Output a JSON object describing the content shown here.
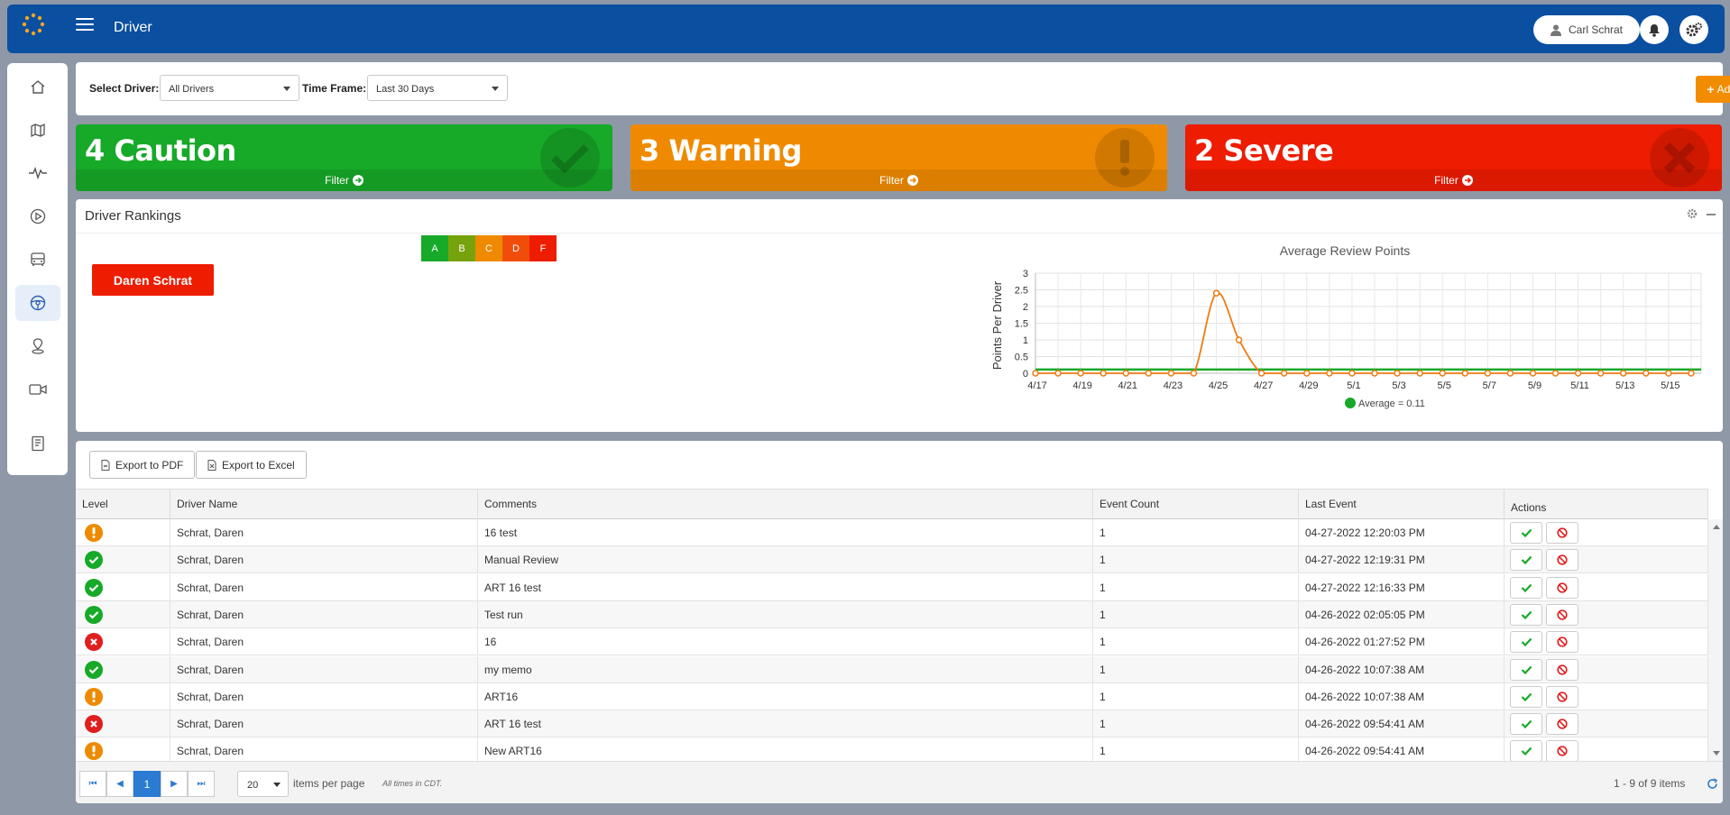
{
  "header": {
    "title": "Driver",
    "user_name": "Carl Schrat"
  },
  "filters": {
    "driver_label": "Select Driver:",
    "driver_value": "All Drivers",
    "timeframe_label": "Time Frame:",
    "timeframe_value": "Last 30 Days",
    "add_review_label": "Add Review"
  },
  "cards": [
    {
      "title": "4 Caution",
      "filter_label": "Filter",
      "color": "#17a928"
    },
    {
      "title": "3 Warning",
      "filter_label": "Filter",
      "color": "#ef8a00"
    },
    {
      "title": "2 Severe",
      "filter_label": "Filter",
      "color": "#ee1c00"
    }
  ],
  "rankings": {
    "title": "Driver Rankings",
    "grades": [
      {
        "label": "A",
        "color": "#17a928"
      },
      {
        "label": "B",
        "color": "#76a20c"
      },
      {
        "label": "C",
        "color": "#ef8a00"
      },
      {
        "label": "D",
        "color": "#f04d0b"
      },
      {
        "label": "F",
        "color": "#ee1c00"
      }
    ],
    "driver_button": "Daren Schrat"
  },
  "chart_data": {
    "type": "line",
    "title": "Average Review Points",
    "ylabel": "Points Per Driver",
    "xlabel": "",
    "ylim": [
      0,
      3
    ],
    "yticks": [
      "0",
      "0.5",
      "1",
      "1.5",
      "2",
      "2.5",
      "3"
    ],
    "x_tick_labels": [
      "4/17",
      "4/19",
      "4/21",
      "4/23",
      "4/25",
      "4/27",
      "4/29",
      "5/1",
      "5/3",
      "5/5",
      "5/7",
      "5/9",
      "5/11",
      "5/13",
      "5/15"
    ],
    "x": [
      "4/17",
      "4/18",
      "4/19",
      "4/20",
      "4/21",
      "4/22",
      "4/23",
      "4/24",
      "4/25",
      "4/26",
      "4/27",
      "4/28",
      "4/29",
      "4/30",
      "5/1",
      "5/2",
      "5/3",
      "5/4",
      "5/5",
      "5/6",
      "5/7",
      "5/8",
      "5/9",
      "5/10",
      "5/11",
      "5/12",
      "5/13",
      "5/14",
      "5/15",
      "5/16"
    ],
    "series": [
      {
        "values": [
          0,
          0,
          0,
          0,
          0,
          0,
          0,
          0,
          2.4,
          1.0,
          0,
          0,
          0,
          0,
          0,
          0,
          0,
          0,
          0,
          0,
          0,
          0,
          0,
          0,
          0,
          0,
          0,
          0,
          0,
          0
        ],
        "color": "#f07a10"
      }
    ],
    "average": {
      "label": "Average = 0.11",
      "value": 0.11,
      "color": "#17a928"
    },
    "grid": true,
    "legend": "bottom"
  },
  "toolbar": {
    "export_pdf": "Export to PDF",
    "export_excel": "Export to Excel"
  },
  "grid": {
    "columns": [
      "Level",
      "Driver Name",
      "Comments",
      "Event Count",
      "Last Event",
      "Actions"
    ],
    "rows": [
      {
        "level": "warning",
        "driver": "Schrat, Daren",
        "comment": "16 test",
        "count": "1",
        "last": "04-27-2022 12:20:03 PM"
      },
      {
        "level": "caution",
        "driver": "Schrat, Daren",
        "comment": "Manual Review",
        "count": "1",
        "last": "04-27-2022 12:19:31 PM"
      },
      {
        "level": "caution",
        "driver": "Schrat, Daren",
        "comment": "ART 16 test",
        "count": "1",
        "last": "04-27-2022 12:16:33 PM"
      },
      {
        "level": "caution",
        "driver": "Schrat, Daren",
        "comment": "Test run",
        "count": "1",
        "last": "04-26-2022 02:05:05 PM"
      },
      {
        "level": "severe",
        "driver": "Schrat, Daren",
        "comment": "16",
        "count": "1",
        "last": "04-26-2022 01:27:52 PM"
      },
      {
        "level": "caution",
        "driver": "Schrat, Daren",
        "comment": "my memo",
        "count": "1",
        "last": "04-26-2022 10:07:38 AM"
      },
      {
        "level": "warning",
        "driver": "Schrat, Daren",
        "comment": "ART16",
        "count": "1",
        "last": "04-26-2022 10:07:38 AM"
      },
      {
        "level": "severe",
        "driver": "Schrat, Daren",
        "comment": "ART 16 test",
        "count": "1",
        "last": "04-26-2022 09:54:41 AM"
      },
      {
        "level": "warning",
        "driver": "Schrat, Daren",
        "comment": "New ART16",
        "count": "1",
        "last": "04-26-2022 09:54:41 AM"
      }
    ]
  },
  "pager": {
    "current_page": "1",
    "page_size": "20",
    "items_per_page": "items per page",
    "timezone_note": "All times in CDT.",
    "summary": "1 - 9 of 9 items"
  }
}
